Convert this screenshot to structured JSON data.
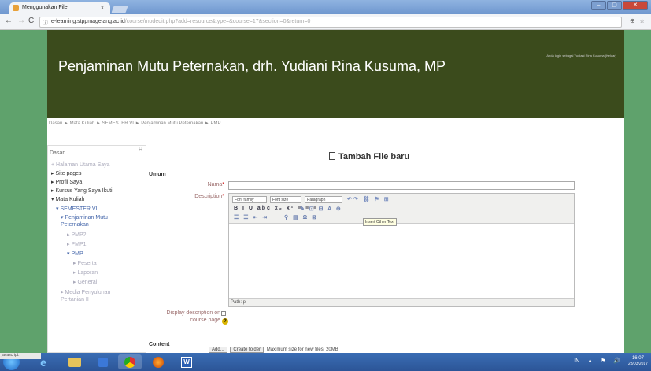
{
  "browser": {
    "tab_title": "Menggunakan File",
    "tab_close": "x",
    "url_host": "e-learning.stppmagelang.ac.id",
    "url_path": "/course/modedit.php?add=resource&type=&course=17&section=0&return=0",
    "window_buttons": [
      "–",
      "▢",
      "✕"
    ]
  },
  "course": {
    "title": "Penjaminan Mutu Peternakan, drh. Yudiani Rina Kusuma, MP",
    "login_info": "Anda login sebagai Yudiani Rina Kusuma (Keluar)"
  },
  "breadcrumb": "Dasan ► Mata Kuliah ► SEMESTER VI ► Penjaminan Mutu Peternakan ► PMP",
  "sidebar": {
    "title": "Dasan",
    "corner_label": "H",
    "items": [
      {
        "label": "Halaman Utama Saya",
        "style": "mute"
      },
      {
        "label": "Site pages",
        "style": "normal"
      },
      {
        "label": "Profil Saya",
        "style": "normal"
      },
      {
        "label": "Kursus Yang Saya Ikuti",
        "style": "normal"
      },
      {
        "label": "Mata Kuliah",
        "style": "normal"
      },
      {
        "label": "SEMESTER VI",
        "style": "blue"
      },
      {
        "label": "Penjaminan Mutu Peternakan",
        "style": "blue"
      },
      {
        "label": "PMP2",
        "style": "mute"
      },
      {
        "label": "PMP1",
        "style": "mute"
      },
      {
        "label": "PMP",
        "style": "blue"
      },
      {
        "label": "Peserta",
        "style": "mute"
      },
      {
        "label": "Laporan",
        "style": "mute"
      },
      {
        "label": "General",
        "style": "mute"
      },
      {
        "label": "Media Penyuluhan Pertanian II",
        "style": "mute"
      }
    ]
  },
  "form": {
    "heading": "Tambah File baru",
    "section_general": "Umum",
    "name_label": "Nama",
    "description_label": "Description",
    "required_mark": "*",
    "font_family": "Font family",
    "font_size": "Font size",
    "paragraph": "Paragraph",
    "toolbar_row2": "B I U abc x₂ x² ≡ ≡ ≡",
    "toolbar_row3": "☰ ☰ ⇤ ⇥",
    "tooltip": "Insert Other Text",
    "path_label": "Path: p",
    "display_desc_label": "Display description on",
    "display_desc_label2": "course page",
    "help_icon_text": "?",
    "section_content": "Content",
    "add_button": "Add...",
    "create_folder_button": "Create folder",
    "max_size_text": "Maximum size for new files: 20MB"
  },
  "status_text": "javascript:",
  "taskbar": {
    "tray_items": [
      "IN",
      "▲",
      "⚑",
      "🔊"
    ],
    "time": "16:07",
    "date": "28/03/2017"
  }
}
